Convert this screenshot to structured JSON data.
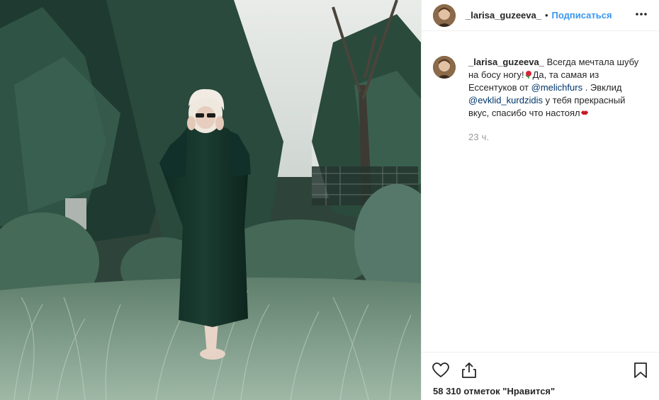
{
  "post": {
    "username": "_larisa_guzeeva_",
    "separator": "•",
    "follow_label": "Подписаться",
    "caption": {
      "username": "_larisa_guzeeva_",
      "text_1": " Всегда мечтала шубу на босу ногу!",
      "text_2": "Да, та самая из Ессентуков от ",
      "mention_1": "@melichfurs",
      "text_3": " . Эвклид ",
      "mention_2": "@evklid_kurdzidis",
      "text_4": " у тебя прекрасный вкус, спасибо что настоял",
      "emoji_1": "rose-emoji",
      "emoji_2": "kiss-lips-emoji"
    },
    "timestamp": "23 ч.",
    "likes_text": "58 310 отметок \"Нравится\""
  },
  "icons": {
    "more": "more-horizontal-icon",
    "like": "heart-icon",
    "share": "share-icon",
    "save": "bookmark-icon"
  },
  "colors": {
    "link": "#3897f0",
    "mention": "#003569",
    "muted": "#999999",
    "border": "#efefef"
  }
}
